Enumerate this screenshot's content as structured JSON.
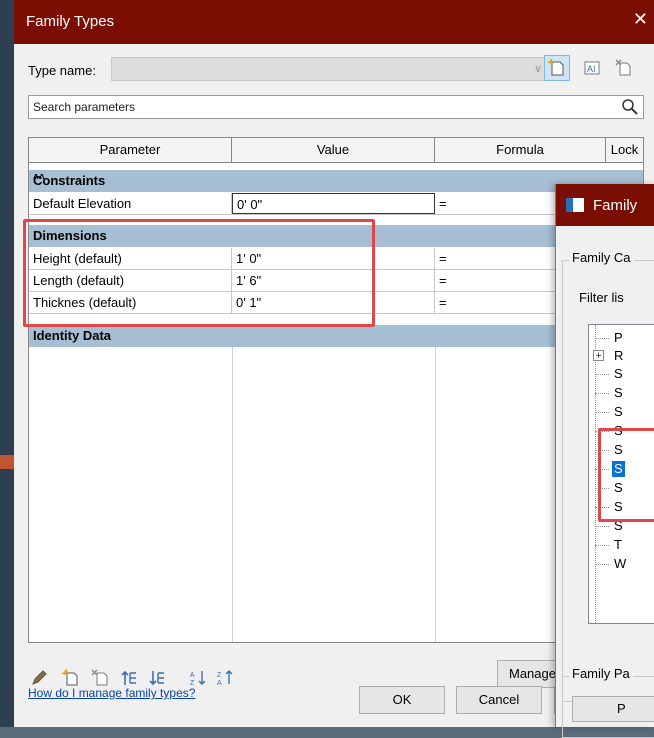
{
  "family_types": {
    "title": "Family Types",
    "close_glyph": "✕",
    "type_name_label": "Type name:",
    "type_name_value": "",
    "search_placeholder": "Search parameters",
    "columns": [
      "Parameter",
      "Value",
      "Formula",
      "Lock"
    ],
    "groups": [
      {
        "name": "Constraints",
        "rows": [
          {
            "parameter": "Default Elevation",
            "value": "0'  0\"",
            "formula": "="
          }
        ]
      },
      {
        "name": "Dimensions",
        "rows": [
          {
            "parameter": "Height (default)",
            "value": "1'  0\"",
            "formula": "="
          },
          {
            "parameter": "Length (default)",
            "value": "1'  6\"",
            "formula": "="
          },
          {
            "parameter": "Thicknes (default)",
            "value": "0'  1\"",
            "formula": "="
          }
        ]
      },
      {
        "name": "Identity Data",
        "rows": []
      }
    ],
    "help_link": "How do I manage family types?",
    "manage_button": "Manage L",
    "ok_button": "OK",
    "cancel_button": "Cancel",
    "highlight_color": "#e0474a",
    "title_bar_color": "#7b0e02",
    "group_header_color": "#a7bfd4"
  },
  "family_category": {
    "title": "Family",
    "group_label": "Family Ca",
    "filter_label": "Filter lis",
    "tree_items": [
      {
        "label": "P",
        "expandable": false,
        "selected": false
      },
      {
        "label": "R",
        "expandable": true,
        "selected": false
      },
      {
        "label": "S",
        "expandable": false,
        "selected": false
      },
      {
        "label": "S",
        "expandable": false,
        "selected": false
      },
      {
        "label": "S",
        "expandable": false,
        "selected": false
      },
      {
        "label": "S",
        "expandable": false,
        "selected": false
      },
      {
        "label": "S",
        "expandable": false,
        "selected": false
      },
      {
        "label": "S",
        "expandable": false,
        "selected": true
      },
      {
        "label": "S",
        "expandable": false,
        "selected": false
      },
      {
        "label": "S",
        "expandable": false,
        "selected": false
      },
      {
        "label": "S",
        "expandable": false,
        "selected": false
      },
      {
        "label": "T",
        "expandable": false,
        "selected": false
      },
      {
        "label": "W",
        "expandable": false,
        "selected": false
      }
    ],
    "params_label": "Family Pa",
    "params_button": "P",
    "selection_color": "#0a6fd6"
  }
}
